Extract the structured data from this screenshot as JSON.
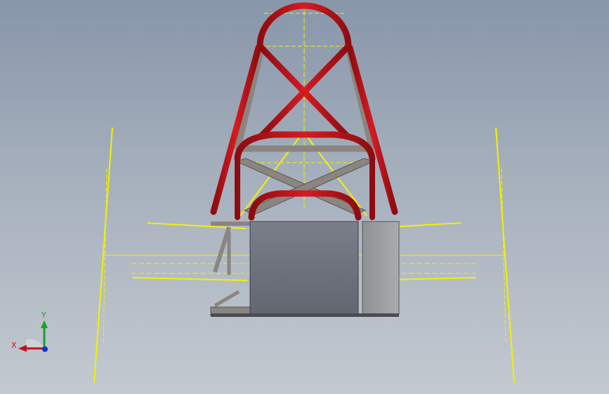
{
  "triad": {
    "y_label": "Y",
    "x_label": "X"
  },
  "colors": {
    "viewport_top": "#8896aa",
    "viewport_bottom": "#c3c9d0",
    "tube_red": "#c8151c",
    "tube_gray": "#8a8580",
    "sketch_yellow": "#f2f200",
    "panel_gray": "#6f7380",
    "side_panel_gray": "#9a9c9f",
    "axis_x": "#c0141a",
    "axis_y": "#1aa02a",
    "axis_z": "#1431c8"
  },
  "icons": [
    "coordinate-triad-icon"
  ]
}
